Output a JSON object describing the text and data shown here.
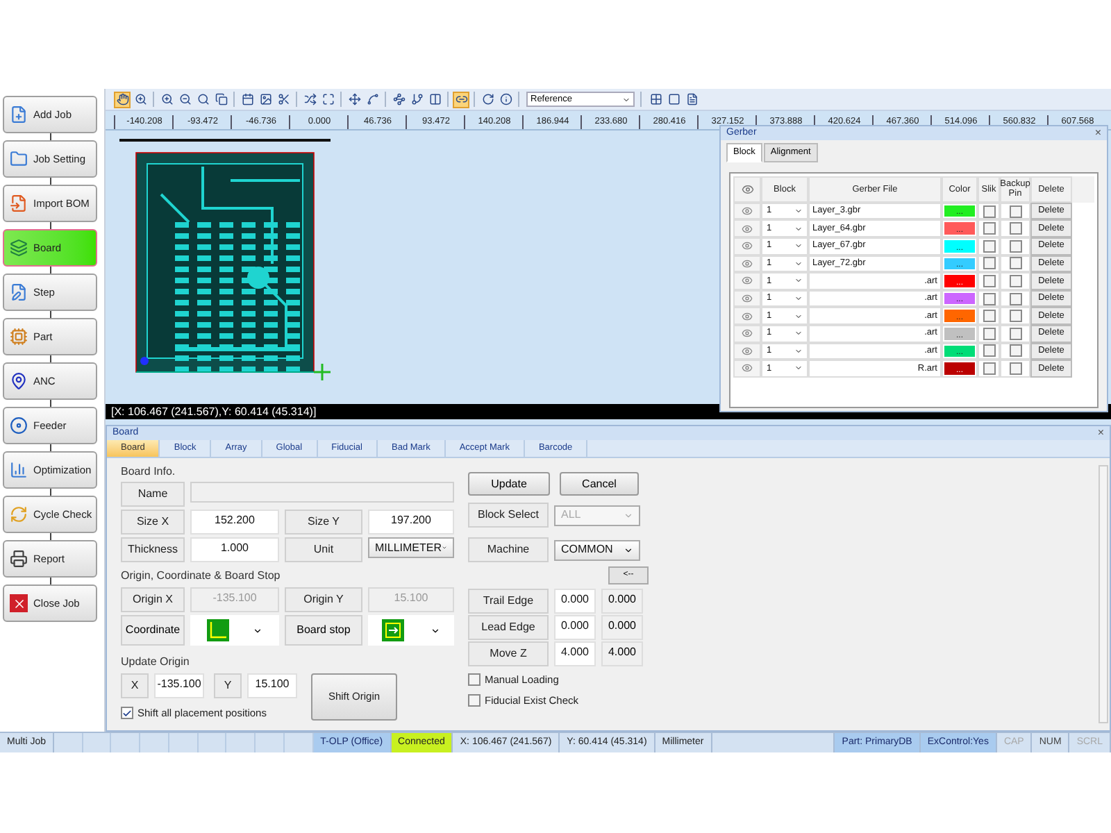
{
  "sidebar": {
    "steps": [
      {
        "label": "Add Job",
        "selected": false
      },
      {
        "label": "Job Setting",
        "selected": false
      },
      {
        "label": "Import BOM",
        "selected": false
      },
      {
        "label": "Board",
        "selected": true
      },
      {
        "label": "Step",
        "selected": false
      },
      {
        "label": "Part",
        "selected": false
      },
      {
        "label": "ANC",
        "selected": false
      },
      {
        "label": "Feeder",
        "selected": false
      },
      {
        "label": "Optimization",
        "selected": false
      },
      {
        "label": "Cycle Check",
        "selected": false
      },
      {
        "label": "Report",
        "selected": false
      },
      {
        "label": "Close Job",
        "selected": false
      }
    ]
  },
  "toolbar": {
    "tools_left": [
      {
        "selected": true
      },
      {
        "selected": false
      },
      {
        "selected": false
      },
      {
        "selected": false
      },
      {
        "selected": false
      },
      {
        "selected": false
      },
      {
        "selected": false
      },
      {
        "selected": false
      },
      {
        "selected": false
      },
      {
        "selected": false
      },
      {
        "selected": false
      },
      {
        "selected": false
      },
      {
        "selected": false
      },
      {
        "selected": false
      },
      {
        "selected": false
      },
      {
        "selected": false
      },
      {
        "selected": true
      },
      {
        "selected": false
      },
      {
        "selected": false
      }
    ],
    "reference": {
      "value": "Reference"
    },
    "tools_right": [
      {
        "selected": false
      },
      {
        "selected": false
      },
      {
        "selected": false
      }
    ]
  },
  "ruler": {
    "ticks": [
      "-140.208",
      "-93.472",
      "-46.736",
      "0.000",
      "46.736",
      "93.472",
      "140.208",
      "186.944",
      "233.680",
      "280.416",
      "327.152",
      "373.888",
      "420.624",
      "467.360",
      "514.096",
      "560.832",
      "607.568"
    ]
  },
  "canvas": {
    "coordinates": "[X: 106.467 (241.567),Y: 60.414 (45.314)]"
  },
  "gerber": {
    "title": "Gerber",
    "close": "×",
    "tabs": [
      {
        "label": "Block",
        "selected": true
      },
      {
        "label": "Alignment",
        "selected": false
      }
    ],
    "columns": [
      "Block",
      "Gerber File",
      "Color",
      "Slik",
      "Backup Pin",
      "Delete"
    ],
    "rows": [
      {
        "block": "1",
        "file": "Layer_3.gbr",
        "scrolled": false,
        "color": "#22ee22",
        "color_button": "...",
        "slik": false,
        "backup_pin": false,
        "delete": "Delete"
      },
      {
        "block": "1",
        "file": "Layer_64.gbr",
        "scrolled": false,
        "color": "#ff5a5a",
        "color_button": "...",
        "slik": false,
        "backup_pin": false,
        "delete": "Delete"
      },
      {
        "block": "1",
        "file": "Layer_67.gbr",
        "scrolled": false,
        "color": "#00ffff",
        "color_button": "...",
        "slik": false,
        "backup_pin": false,
        "delete": "Delete"
      },
      {
        "block": "1",
        "file": "Layer_72.gbr",
        "scrolled": false,
        "color": "#33ccff",
        "color_button": "...",
        "slik": false,
        "backup_pin": false,
        "delete": "Delete"
      },
      {
        "block": "1",
        "file": ".art",
        "scrolled": true,
        "color": "#ff0000",
        "color_button": "...",
        "slik": false,
        "backup_pin": false,
        "delete": "Delete"
      },
      {
        "block": "1",
        "file": ".art",
        "scrolled": true,
        "color": "#cc66ff",
        "color_button": "...",
        "slik": false,
        "backup_pin": false,
        "delete": "Delete"
      },
      {
        "block": "1",
        "file": ".art",
        "scrolled": true,
        "color": "#ff6600",
        "color_button": "...",
        "slik": false,
        "backup_pin": false,
        "delete": "Delete"
      },
      {
        "block": "1",
        "file": ".art",
        "scrolled": true,
        "color": "#c0c0c0",
        "color_button": "...",
        "slik": false,
        "backup_pin": false,
        "delete": "Delete"
      },
      {
        "block": "1",
        "file": ".art",
        "scrolled": true,
        "color": "#00dd77",
        "color_button": "...",
        "slik": false,
        "backup_pin": false,
        "delete": "Delete"
      },
      {
        "block": "1",
        "file": "R.art",
        "scrolled": true,
        "color": "#bb0000",
        "color_button": "...",
        "slik": false,
        "backup_pin": false,
        "delete": "Delete"
      }
    ]
  },
  "board": {
    "title": "Board",
    "close": "×",
    "tabs": [
      {
        "label": "Board",
        "selected": true
      },
      {
        "label": "Block",
        "selected": false
      },
      {
        "label": "Array",
        "selected": false
      },
      {
        "label": "Global",
        "selected": false
      },
      {
        "label": "Fiducial",
        "selected": false
      },
      {
        "label": "Bad Mark",
        "selected": false
      },
      {
        "label": "Accept Mark",
        "selected": false
      },
      {
        "label": "Barcode",
        "selected": false
      }
    ],
    "board_info": {
      "heading": "Board Info.",
      "name": {
        "label": "Name"
      },
      "size_x": {
        "label": "Size X",
        "value": "152.200"
      },
      "size_y": {
        "label": "Size Y",
        "value": "197.200"
      },
      "thickness": {
        "label": "Thickness",
        "value": "1.000"
      },
      "unit": {
        "label": "Unit",
        "value": "MILLIMETER"
      }
    },
    "origin": {
      "heading": "Origin, Coordinate & Board Stop",
      "origin_x": {
        "label": "Origin X",
        "value": "-135.100",
        "disabled": true
      },
      "origin_y": {
        "label": "Origin Y",
        "value": "15.100",
        "disabled": true
      },
      "coordinate": {
        "label": "Coordinate"
      },
      "board_stop": {
        "label": "Board stop"
      }
    },
    "update_origin": {
      "heading": "Update Origin",
      "x": {
        "label": "X",
        "value": "-135.100"
      },
      "y": {
        "label": "Y",
        "value": "15.100"
      },
      "shift_button": "Shift Origin",
      "shift_all": {
        "label": "Shift all placement positions",
        "checked": true
      }
    },
    "actions": {
      "update": "Update",
      "cancel": "Cancel"
    },
    "block_select": {
      "label": "Block Select",
      "value": "ALL",
      "disabled": true
    },
    "machine": {
      "label": "Machine",
      "value": "COMMON",
      "arrow_button": "<--"
    },
    "edges": [
      {
        "label": "Trail Edge",
        "value": "0.000",
        "machine_value": "0.000"
      },
      {
        "label": "Lead Edge",
        "value": "0.000",
        "machine_value": "0.000"
      },
      {
        "label": "Move Z",
        "value": "4.000",
        "machine_value": "4.000"
      }
    ],
    "options": [
      {
        "label": "Manual Loading",
        "checked": false
      },
      {
        "label": "Fiducial Exist Check",
        "checked": false
      }
    ]
  },
  "status_bar": {
    "cells": [
      {
        "text": "Multi Job",
        "kind": "plain"
      },
      {
        "text": "T-OLP (Office)",
        "kind": "info"
      },
      {
        "text": "Connected",
        "kind": "ok"
      },
      {
        "text": "X: 106.467 (241.567)",
        "kind": "plain"
      },
      {
        "text": "Y: 60.414 (45.314)",
        "kind": "plain"
      },
      {
        "text": "Millimeter",
        "kind": "plain"
      },
      {
        "text": "Part: PrimaryDB",
        "kind": "info"
      },
      {
        "text": "ExControl:Yes",
        "kind": "info"
      },
      {
        "text": "CAP",
        "kind": "off"
      },
      {
        "text": "NUM",
        "kind": "on"
      },
      {
        "text": "SCRL",
        "kind": "off"
      }
    ]
  }
}
